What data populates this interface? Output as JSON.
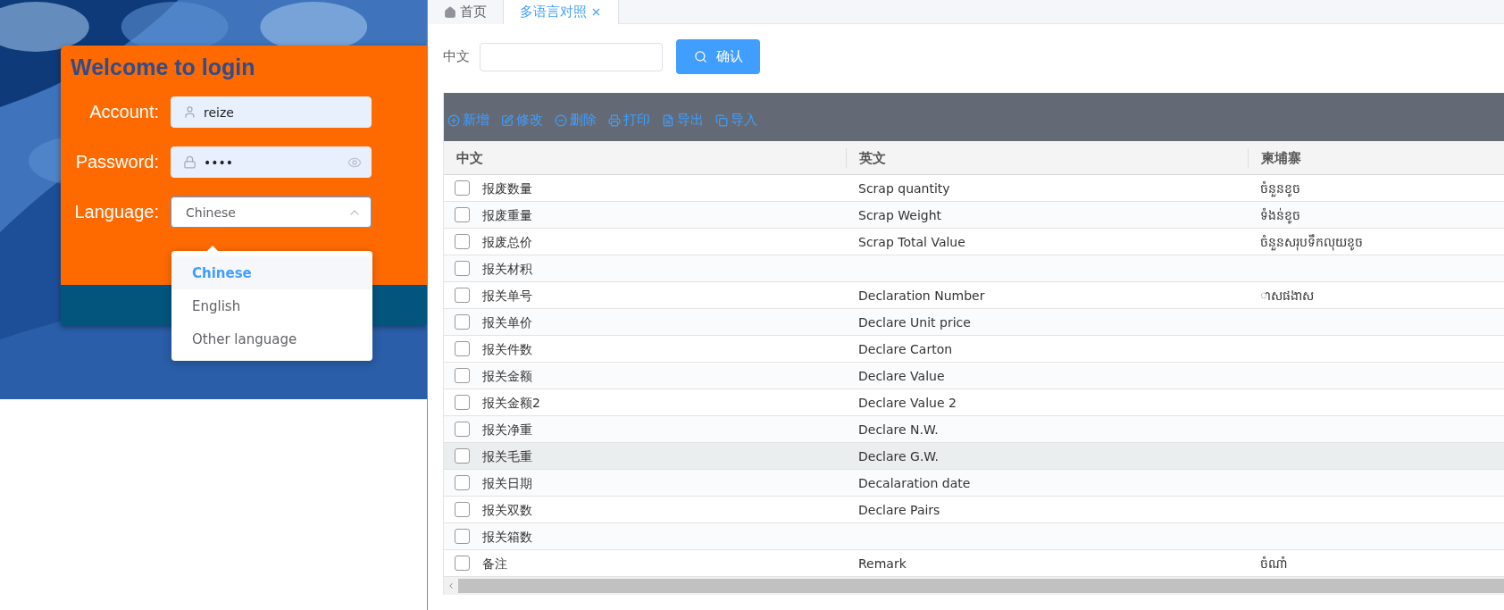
{
  "login": {
    "title": "Welcome to login",
    "fields": [
      {
        "kind": "text",
        "label": "Account:",
        "value": "reize"
      },
      {
        "kind": "password",
        "label": "Password:",
        "value": "••••"
      },
      {
        "kind": "select",
        "label": "Language:",
        "value": "Chinese",
        "expanded": true
      }
    ],
    "language_options": [
      {
        "label": "Chinese",
        "selected": true
      },
      {
        "label": "English",
        "selected": false
      },
      {
        "label": "Other language",
        "selected": false
      }
    ]
  },
  "tabs": [
    {
      "kind": "home",
      "label": "首页",
      "selected": false
    },
    {
      "kind": "closable",
      "label": "多语言对照",
      "selected": true
    }
  ],
  "search": {
    "label": "中文",
    "button": "确认"
  },
  "toolbar": [
    {
      "kind": "add",
      "label": "新增"
    },
    {
      "kind": "edit",
      "label": "修改"
    },
    {
      "kind": "delete",
      "label": "删除"
    },
    {
      "kind": "print",
      "label": "打印"
    },
    {
      "kind": "export",
      "label": "导出"
    },
    {
      "kind": "import",
      "label": "导入"
    }
  ],
  "table": {
    "columns": [
      "中文",
      "英文",
      "柬埔寨"
    ],
    "rows": [
      {
        "cells": [
          "报废数量",
          "Scrap quantity",
          "ចំនួនខូច"
        ],
        "checked": false,
        "highlighted": false
      },
      {
        "cells": [
          "报废重量",
          "Scrap Weight",
          "ទំងន់ខូច"
        ],
        "checked": false,
        "highlighted": false
      },
      {
        "cells": [
          "报废总价",
          "Scrap Total Value",
          "ចំនួនសរុបទឹកលុយខូច"
        ],
        "checked": false,
        "highlighted": false
      },
      {
        "cells": [
          "报关材积",
          "",
          ""
        ],
        "checked": false,
        "highlighted": false
      },
      {
        "cells": [
          "报关单号",
          "Declaration Number",
          "ាសផងាស"
        ],
        "checked": false,
        "highlighted": false
      },
      {
        "cells": [
          "报关单价",
          "Declare Unit price",
          ""
        ],
        "checked": false,
        "highlighted": false
      },
      {
        "cells": [
          "报关件数",
          "Declare Carton",
          ""
        ],
        "checked": false,
        "highlighted": false
      },
      {
        "cells": [
          "报关金额",
          "Declare Value",
          ""
        ],
        "checked": false,
        "highlighted": false
      },
      {
        "cells": [
          "报关金额2",
          "Declare Value 2",
          ""
        ],
        "checked": false,
        "highlighted": false
      },
      {
        "cells": [
          "报关净重",
          "Declare N.W.",
          ""
        ],
        "checked": false,
        "highlighted": false
      },
      {
        "cells": [
          "报关毛重",
          "Declare G.W.",
          ""
        ],
        "checked": false,
        "highlighted": true
      },
      {
        "cells": [
          "报关日期",
          "Decalaration date",
          ""
        ],
        "checked": false,
        "highlighted": false
      },
      {
        "cells": [
          "报关双数",
          "Declare Pairs",
          ""
        ],
        "checked": false,
        "highlighted": false
      },
      {
        "cells": [
          "报关箱数",
          "",
          ""
        ],
        "checked": false,
        "highlighted": false
      },
      {
        "cells": [
          "备注",
          "Remark",
          "ចំណាំ"
        ],
        "checked": false,
        "highlighted": false
      }
    ]
  }
}
